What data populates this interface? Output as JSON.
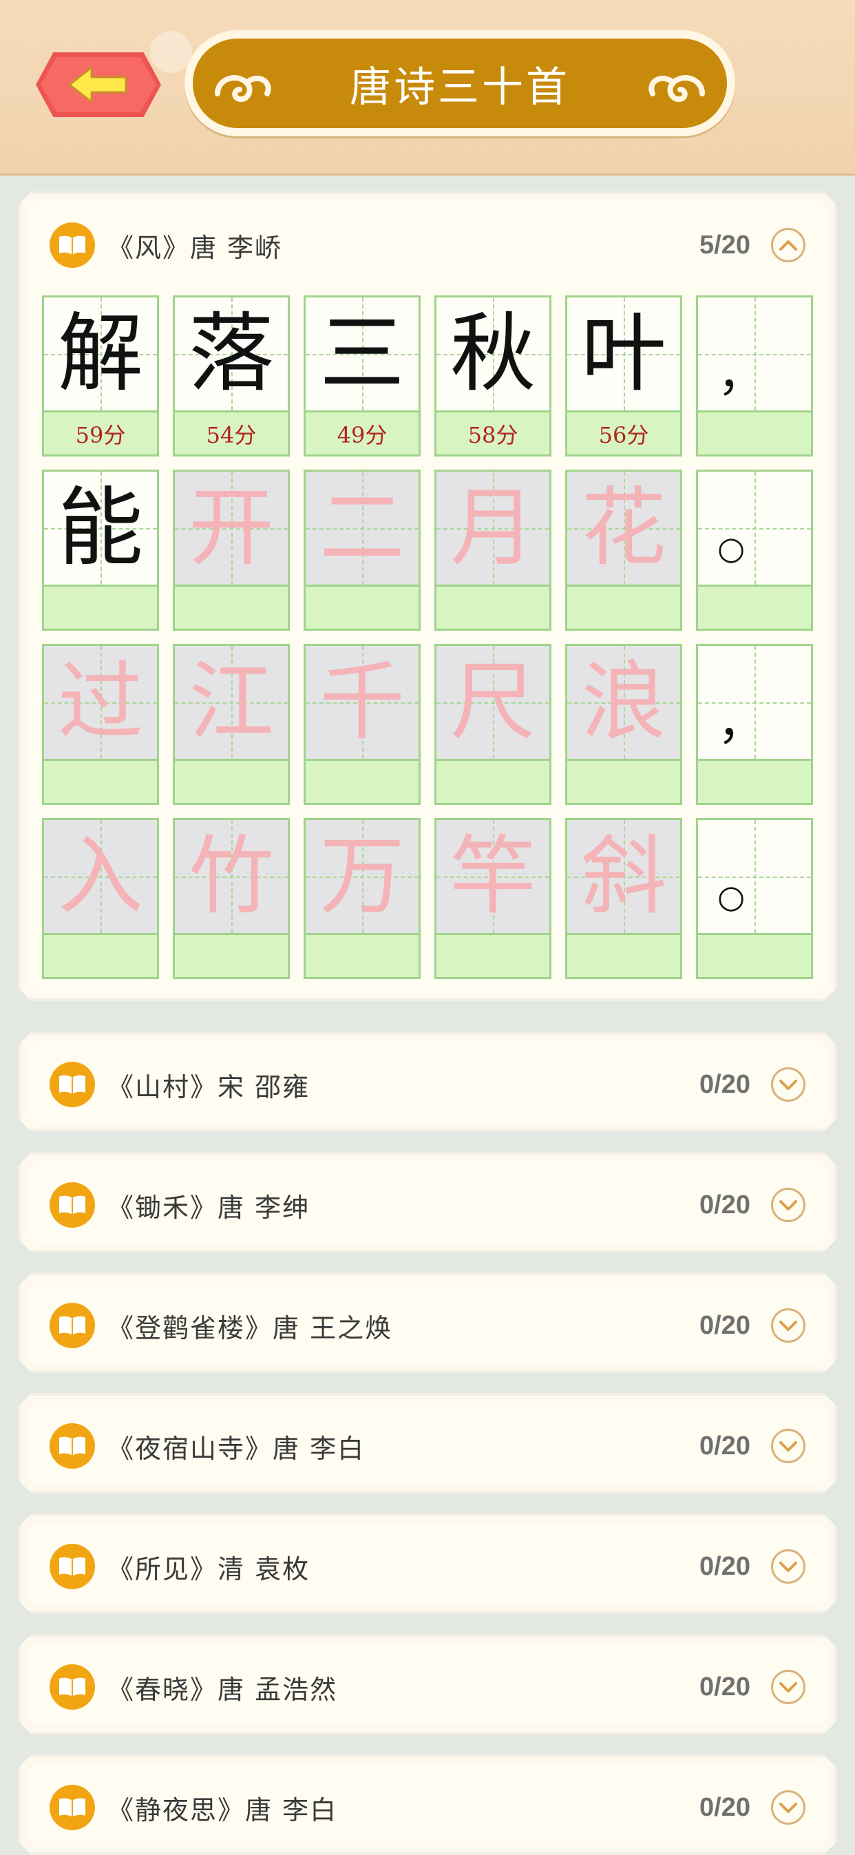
{
  "header": {
    "title": "唐诗三十首",
    "back_icon": "arrow-left-icon"
  },
  "expanded_poem": {
    "title": "《风》唐 李峤",
    "progress": "5/20",
    "rows": [
      [
        {
          "char": "解",
          "score": "59分",
          "state": "done"
        },
        {
          "char": "落",
          "score": "54分",
          "state": "done"
        },
        {
          "char": "三",
          "score": "49分",
          "state": "done"
        },
        {
          "char": "秋",
          "score": "58分",
          "state": "done"
        },
        {
          "char": "叶",
          "score": "56分",
          "state": "done"
        },
        {
          "char": "，",
          "score": "",
          "state": "punct"
        }
      ],
      [
        {
          "char": "能",
          "score": "",
          "state": "done"
        },
        {
          "char": "开",
          "score": "",
          "state": "locked"
        },
        {
          "char": "二",
          "score": "",
          "state": "locked"
        },
        {
          "char": "月",
          "score": "",
          "state": "locked"
        },
        {
          "char": "花",
          "score": "",
          "state": "locked"
        },
        {
          "char": "○",
          "score": "",
          "state": "period"
        }
      ],
      [
        {
          "char": "过",
          "score": "",
          "state": "locked"
        },
        {
          "char": "江",
          "score": "",
          "state": "locked"
        },
        {
          "char": "千",
          "score": "",
          "state": "locked"
        },
        {
          "char": "尺",
          "score": "",
          "state": "locked"
        },
        {
          "char": "浪",
          "score": "",
          "state": "locked"
        },
        {
          "char": "，",
          "score": "",
          "state": "punct"
        }
      ],
      [
        {
          "char": "入",
          "score": "",
          "state": "locked"
        },
        {
          "char": "竹",
          "score": "",
          "state": "locked"
        },
        {
          "char": "万",
          "score": "",
          "state": "locked"
        },
        {
          "char": "竿",
          "score": "",
          "state": "locked"
        },
        {
          "char": "斜",
          "score": "",
          "state": "locked"
        },
        {
          "char": "○",
          "score": "",
          "state": "period"
        }
      ]
    ]
  },
  "collapsed_poems": [
    {
      "title": "《山村》宋 邵雍",
      "progress": "0/20"
    },
    {
      "title": "《锄禾》唐 李绅",
      "progress": "0/20"
    },
    {
      "title": "《登鹳雀楼》唐 王之焕",
      "progress": "0/20"
    },
    {
      "title": "《夜宿山寺》唐 李白",
      "progress": "0/20"
    },
    {
      "title": "《所见》清 袁枚",
      "progress": "0/20"
    },
    {
      "title": "《春晓》唐 孟浩然",
      "progress": "0/20"
    },
    {
      "title": "《静夜思》唐 李白",
      "progress": "0/20"
    }
  ],
  "colors": {
    "accent": "#f2a512",
    "title_bar": "#c88a0a",
    "back_button": "#ee5451",
    "score_text": "#b3241c",
    "grid_line": "#9fd48a",
    "locked_char": "#f4b3b6"
  },
  "icons": {
    "book": "book-icon",
    "collapse": "chevron-up-icon",
    "expand": "chevron-down-icon"
  }
}
